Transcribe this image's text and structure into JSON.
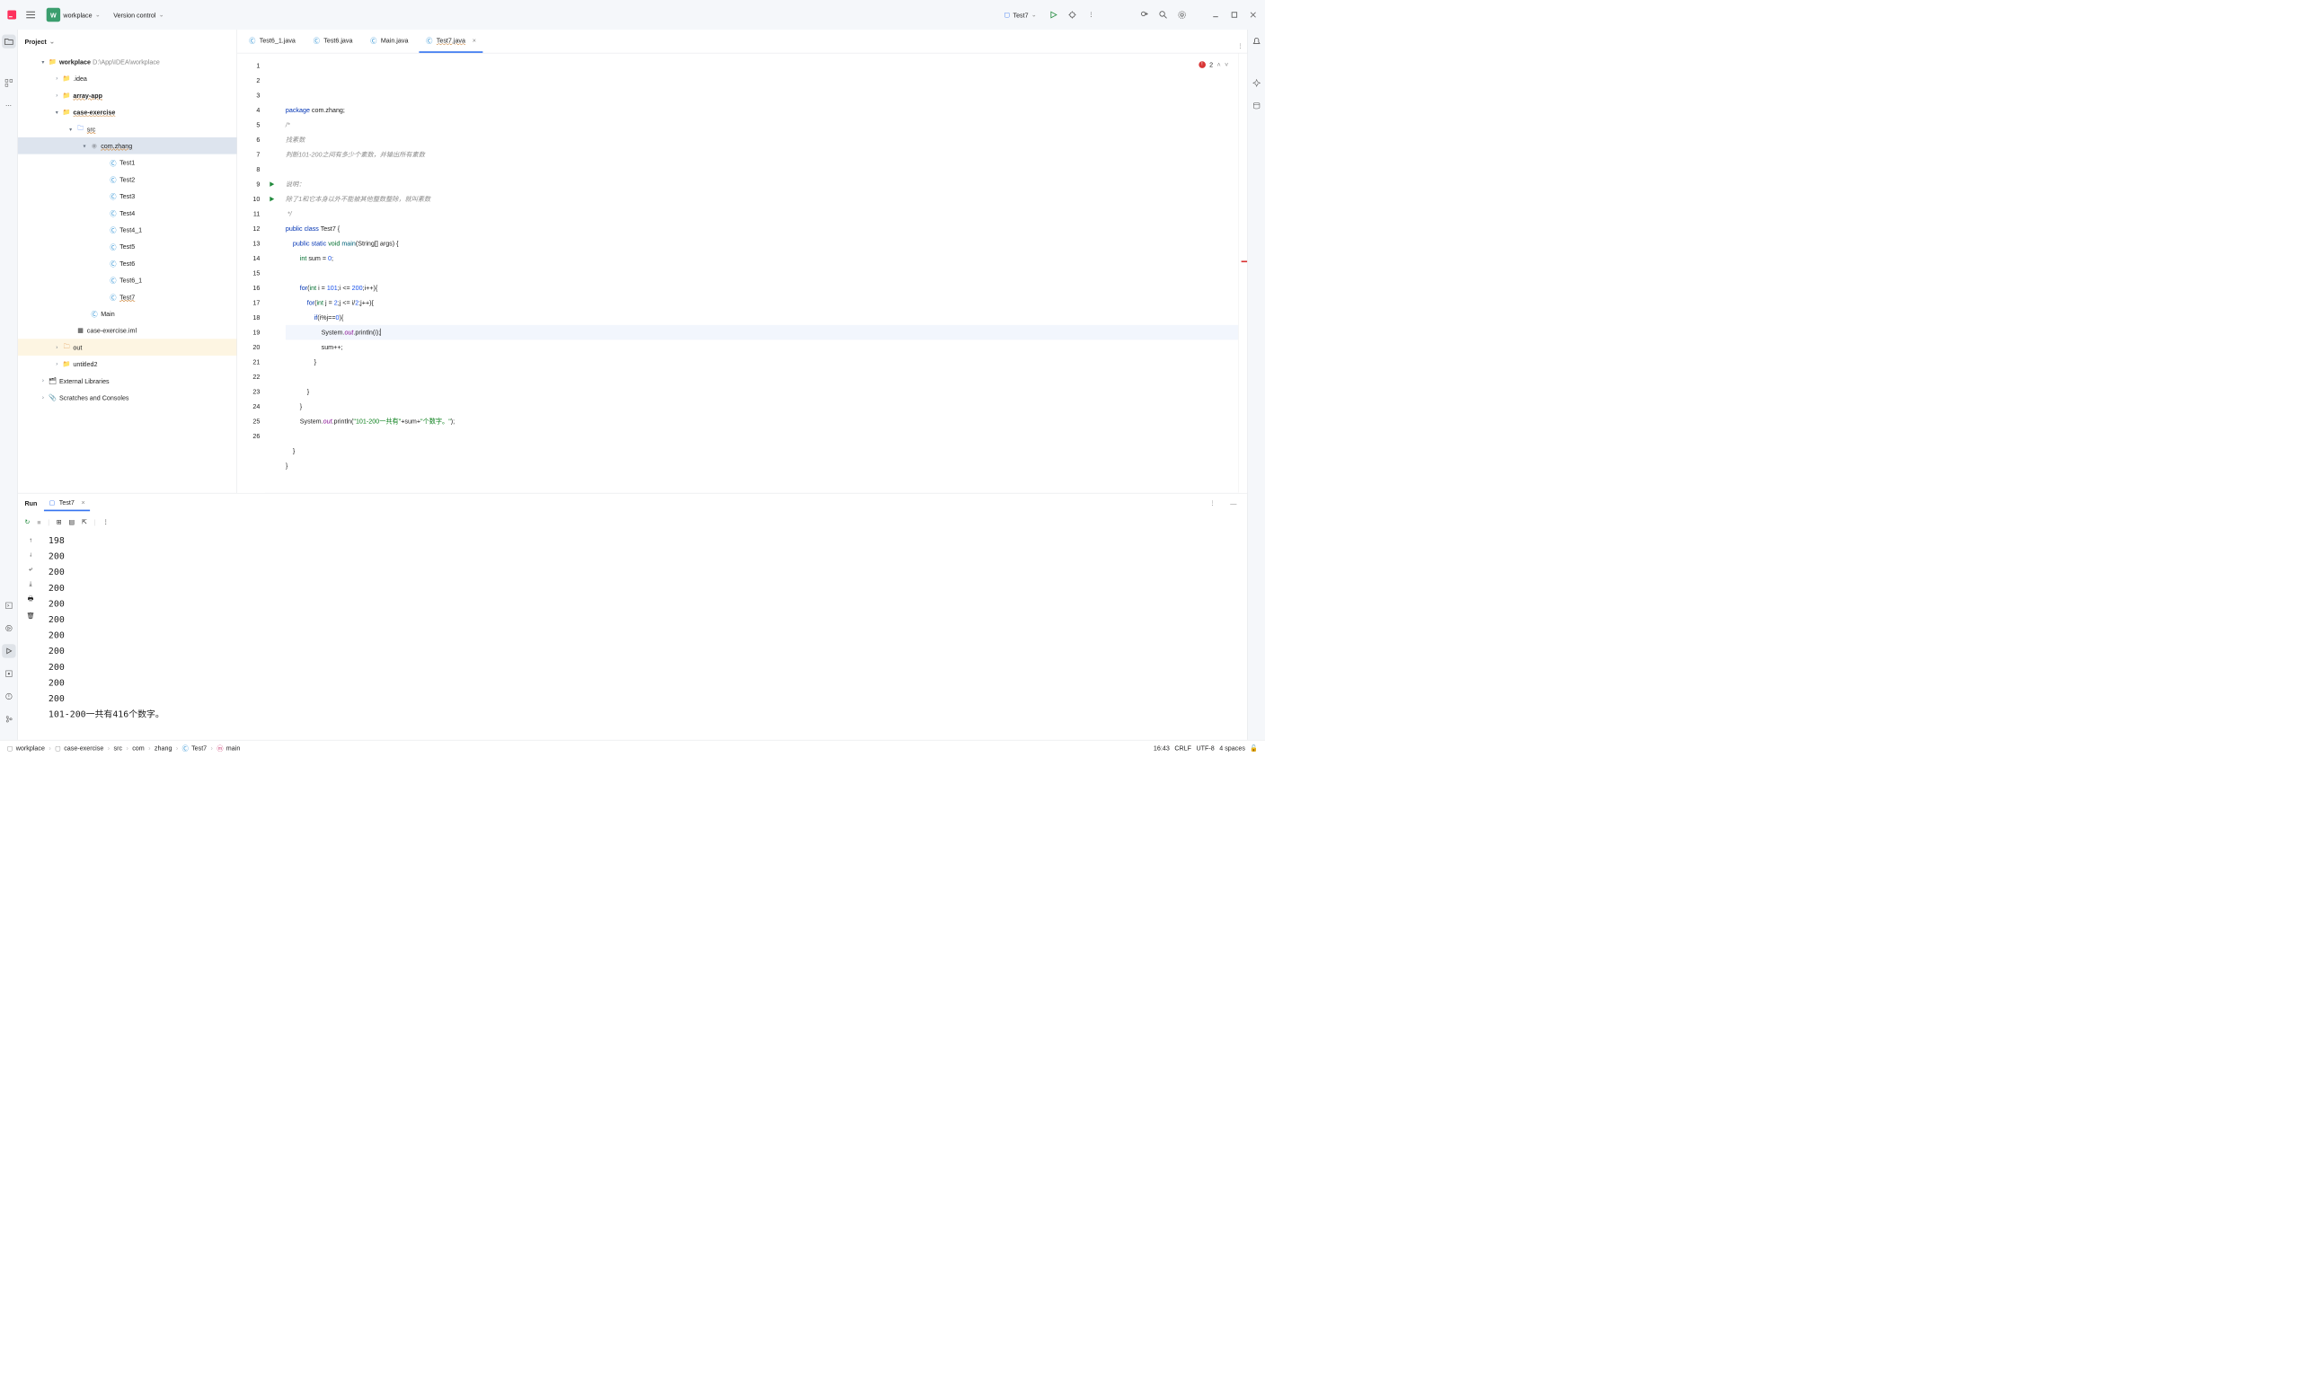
{
  "top": {
    "workspace": "workplace",
    "vc": "Version control",
    "runcfg": "Test7"
  },
  "project": {
    "label": "Project",
    "root": "workplace",
    "rootpath": "D:\\App\\IDEA\\workplace",
    "nodes": [
      {
        "ind": 28,
        "chv": "▾",
        "ico": "📁",
        "txt": "workplace",
        "path": "D:\\App\\IDEA\\workplace",
        "bold": true
      },
      {
        "ind": 56,
        "chv": "›",
        "ico": "📁",
        "txt": ".idea"
      },
      {
        "ind": 56,
        "chv": "›",
        "ico": "📁",
        "txt": "array-app",
        "bold": true,
        "wavy": true
      },
      {
        "ind": 56,
        "chv": "▾",
        "ico": "📁",
        "txt": "case-exercise",
        "bold": true,
        "wavy": true
      },
      {
        "ind": 84,
        "chv": "▾",
        "ico": "📁",
        "txt": "src",
        "wavy": true,
        "src": true
      },
      {
        "ind": 112,
        "chv": "▾",
        "ico": "📦",
        "txt": "com.zhang",
        "sel": true,
        "wavy": true
      },
      {
        "ind": 150,
        "chv": "",
        "ico": "Ⓒ",
        "txt": "Test1"
      },
      {
        "ind": 150,
        "chv": "",
        "ico": "Ⓒ",
        "txt": "Test2"
      },
      {
        "ind": 150,
        "chv": "",
        "ico": "Ⓒ",
        "txt": "Test3"
      },
      {
        "ind": 150,
        "chv": "",
        "ico": "Ⓒ",
        "txt": "Test4"
      },
      {
        "ind": 150,
        "chv": "",
        "ico": "Ⓒ",
        "txt": "Test4_1"
      },
      {
        "ind": 150,
        "chv": "",
        "ico": "Ⓒ",
        "txt": "Test5"
      },
      {
        "ind": 150,
        "chv": "",
        "ico": "Ⓒ",
        "txt": "Test6"
      },
      {
        "ind": 150,
        "chv": "",
        "ico": "Ⓒ",
        "txt": "Test6_1"
      },
      {
        "ind": 150,
        "chv": "",
        "ico": "Ⓒ",
        "txt": "Test7",
        "wavy": true
      },
      {
        "ind": 112,
        "chv": "",
        "ico": "Ⓒ",
        "txt": "Main"
      },
      {
        "ind": 84,
        "chv": "",
        "ico": "▦",
        "txt": "case-exercise.iml"
      },
      {
        "ind": 56,
        "chv": "›",
        "ico": "📁",
        "txt": "out",
        "hl": true,
        "orange": true
      },
      {
        "ind": 56,
        "chv": "›",
        "ico": "📁",
        "txt": "untitled2"
      },
      {
        "ind": 28,
        "chv": "›",
        "ico": "🗂",
        "txt": "External Libraries"
      },
      {
        "ind": 28,
        "chv": "›",
        "ico": "📎",
        "txt": "Scratches and Consoles"
      }
    ]
  },
  "tabs": [
    {
      "txt": "Test6_1.java"
    },
    {
      "txt": "Test6.java"
    },
    {
      "txt": "Main.java"
    },
    {
      "txt": "Test7.java",
      "active": true,
      "wavy": true,
      "close": true
    }
  ],
  "gutter": [
    "1",
    "2",
    "3",
    "4",
    "5",
    "6",
    "7",
    "8",
    "9",
    "10",
    "11",
    "12",
    "13",
    "14",
    "15",
    "16",
    "17",
    "18",
    "19",
    "20",
    "21",
    "22",
    "23",
    "24",
    "25",
    "26"
  ],
  "runmarks": [
    9,
    10
  ],
  "currentLine": 16,
  "errors": "2",
  "run": {
    "title": "Run",
    "tab": "Test7",
    "out": [
      "198",
      "200",
      "200",
      "200",
      "200",
      "200",
      "200",
      "200",
      "200",
      "200",
      "200",
      "101-200一共有416个数字。"
    ]
  },
  "crumbs": [
    "workplace",
    "case-exercise",
    "src",
    "com",
    "zhang",
    "Test7",
    "main"
  ],
  "status": {
    "pos": "16:43",
    "eol": "CRLF",
    "enc": "UTF-8",
    "indent": "4 spaces"
  }
}
